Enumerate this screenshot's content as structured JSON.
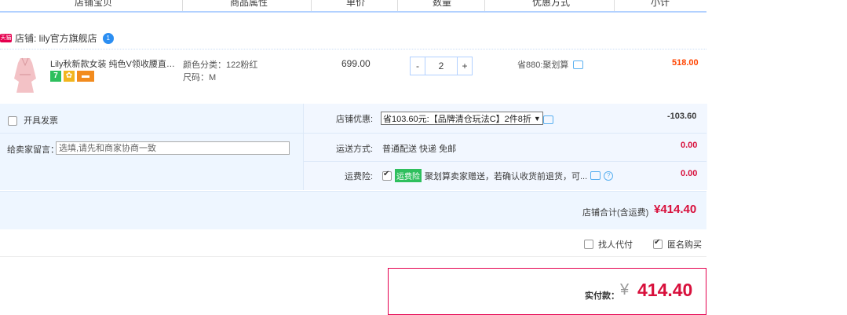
{
  "header": {
    "columns": [
      "店铺宝贝",
      "商品属性",
      "单价",
      "数量",
      "优惠方式",
      "小计"
    ]
  },
  "shop": {
    "badge": "天猫",
    "label": "店铺: lily官方旗舰店",
    "wangwang_icon": "wangwang-chat-icon",
    "wangwang_count": "1"
  },
  "item": {
    "title": "Lily秋新款女装 纯色V领收腰直筒...",
    "badges": [
      "7",
      "",
      ""
    ],
    "badge_colors": [
      "#2ebf5d",
      "#f2b51e",
      "#f28b1e"
    ],
    "attr_color": "颜色分类：122粉红",
    "attr_size": "尺码：M",
    "unit_price": "699.00",
    "quantity": "2",
    "qty_minus": "-",
    "qty_plus": "+",
    "promo": "省880:聚划算",
    "subtotal": "518.00"
  },
  "invoice": {
    "label": "开具发票",
    "checked": false
  },
  "message": {
    "label": "给卖家留言：",
    "placeholder": "选填,请先和商家协商一致"
  },
  "shop_discount": {
    "label": "店铺优惠:",
    "selected": "省103.60元:【品牌清仓玩法C】2件8折",
    "amount": "-103.60"
  },
  "shipping": {
    "label": "运送方式:",
    "value": "普通配送 快递 免邮",
    "amount": "0.00"
  },
  "insurance": {
    "label": "运费险:",
    "badge": "运费险",
    "text": "聚划算卖家赠送，若确认收货前退货，可...",
    "amount": "0.00",
    "checked": true
  },
  "shop_total": {
    "label": "店铺合计(含运费)",
    "value": "¥414.40"
  },
  "options": {
    "proxy_pay": "找人代付",
    "proxy_checked": false,
    "anonymous": "匿名购买",
    "anonymous_checked": true
  },
  "payment": {
    "label": "实付款：",
    "currency": "¥",
    "value": "414.40"
  },
  "colors": {
    "accent_blue": "#b2d1ff",
    "price_red": "#f40",
    "total_crimson": "#d8103c",
    "tmall_red": "#e5004f"
  }
}
